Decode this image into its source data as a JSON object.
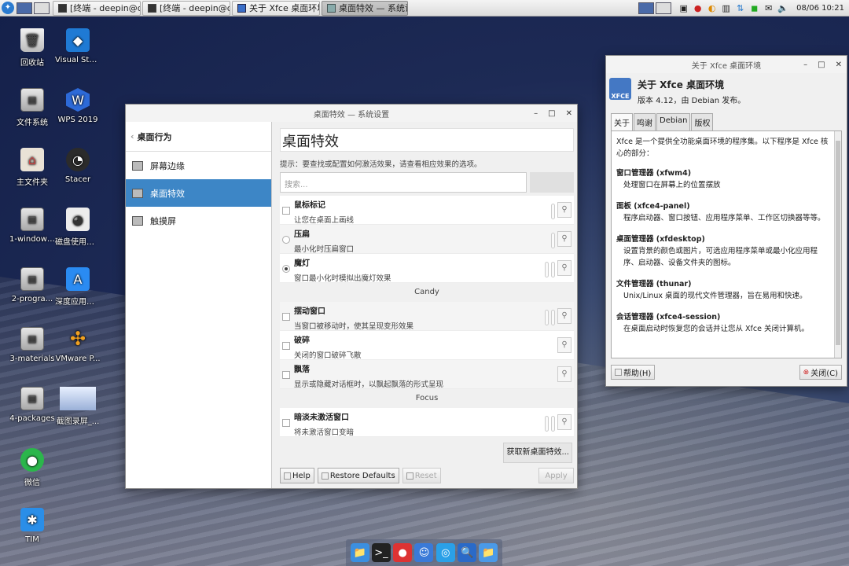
{
  "top_panel": {
    "menu_glyph": "✦",
    "tasks": [
      {
        "label": "[终端 - deepin@dep-f...",
        "kind": "term"
      },
      {
        "label": "[终端 - deepin@dep-f...",
        "kind": "term"
      },
      {
        "label": "关于 Xfce 桌面环境",
        "kind": "xfce"
      },
      {
        "label": "桌面特效 — 系统设置",
        "kind": "settings",
        "active": true
      }
    ],
    "clock": "08/06 10:21"
  },
  "desktop_icons": [
    {
      "label": "回收站",
      "glyph": "🗑"
    },
    {
      "label": "Visual Stu...",
      "glyph": "◆"
    },
    {
      "label": "文件系统",
      "glyph": "▤"
    },
    {
      "label": "WPS 2019",
      "glyph": "W"
    },
    {
      "label": "主文件夹",
      "glyph": "⌂"
    },
    {
      "label": "Stacer",
      "glyph": "◔"
    },
    {
      "label": "1-windows...",
      "glyph": "▤"
    },
    {
      "label": "磁盘使用情...",
      "glyph": "◕"
    },
    {
      "label": "2-progra...",
      "glyph": "▤"
    },
    {
      "label": "深度应用商店",
      "glyph": "A"
    },
    {
      "label": "3-materials",
      "glyph": "▤"
    },
    {
      "label": "VMware P...",
      "glyph": "✣"
    },
    {
      "label": "4-packages",
      "glyph": "▤"
    },
    {
      "label": "截图录屏_...",
      "glyph": ""
    },
    {
      "label": "微信",
      "glyph": "●"
    },
    {
      "label": "TIM",
      "glyph": "✱"
    }
  ],
  "settings": {
    "window_title": "桌面特效 — 系统设置",
    "back_label": "桌面行为",
    "nav_items": [
      {
        "label": "屏幕边缘",
        "selected": false
      },
      {
        "label": "桌面特效",
        "selected": true
      },
      {
        "label": "触摸屏",
        "selected": false
      }
    ],
    "heading": "桌面特效",
    "hint": "提示：要查找或配置如何激活效果，请查看相应效果的选项。",
    "search_placeholder": "搜索...",
    "effects": [
      {
        "type": "effect",
        "name": "鼠标标记",
        "desc": "让您在桌面上画线",
        "control": "checkbox",
        "checked": false,
        "sliders": 1
      },
      {
        "type": "effect",
        "name": "压扁",
        "desc": "最小化时压扁窗口",
        "control": "radio",
        "checked": false,
        "sliders": 1
      },
      {
        "type": "effect",
        "name": "魔灯",
        "desc": "窗口最小化时模拟出魔灯效果",
        "control": "radio",
        "checked": true,
        "sliders": 2
      },
      {
        "type": "group",
        "name": "Candy"
      },
      {
        "type": "effect",
        "name": "摆动窗口",
        "desc": "当窗口被移动时，使其呈现变形效果",
        "control": "checkbox",
        "checked": false,
        "sliders": 2
      },
      {
        "type": "effect",
        "name": "破碎",
        "desc": "关闭的窗口破碎飞散",
        "control": "checkbox",
        "checked": false,
        "sliders": 0
      },
      {
        "type": "effect",
        "name": "飘落",
        "desc": "显示或隐藏对话框时，以飘起飘落的形式呈现",
        "control": "checkbox",
        "checked": false,
        "sliders": 0
      },
      {
        "type": "group",
        "name": "Focus"
      },
      {
        "type": "effect",
        "name": "暗淡未激活窗口",
        "desc": "将未激活窗口变暗",
        "control": "checkbox",
        "checked": false,
        "sliders": 2
      }
    ],
    "get_more": "获取新桌面特效...",
    "buttons": {
      "help": "Help",
      "restore": "Restore Defaults",
      "reset": "Reset",
      "apply": "Apply"
    }
  },
  "about": {
    "window_title": "关于 Xfce 桌面环境",
    "logo_text": "XFCE",
    "title": "关于 Xfce 桌面环境",
    "subtitle": "版本 4.12，由 Debian 发布。",
    "tabs": [
      "关于",
      "鸣谢",
      "Debian",
      "版权"
    ],
    "intro": "Xfce 是一个提供全功能桌面环境的程序集。以下程序是 Xfce 核心的部分：",
    "components": [
      {
        "name": "窗口管理器 (xfwm4)",
        "desc": "处理窗口在屏幕上的位置摆放"
      },
      {
        "name": "面板 (xfce4-panel)",
        "desc": "程序启动器、窗口按钮、应用程序菜单、工作区切换器等等。"
      },
      {
        "name": "桌面管理器 (xfdesktop)",
        "desc": "设置背景的颜色或图片，可选应用程序菜单或最小化应用程序、启动器、设备文件夹的图标。"
      },
      {
        "name": "文件管理器 (thunar)",
        "desc": "Unix/Linux 桌面的现代文件管理器，旨在易用和快速。"
      },
      {
        "name": "会话管理器 (xfce4-session)",
        "desc": "在桌面启动时恢复您的会话并让您从 Xfce 关闭计算机。"
      }
    ],
    "help_button": "帮助(H)",
    "close_button": "关闭(C)"
  },
  "dock": [
    "📁",
    ">_",
    "●",
    "☺",
    "◎",
    "🔍",
    "📁"
  ]
}
